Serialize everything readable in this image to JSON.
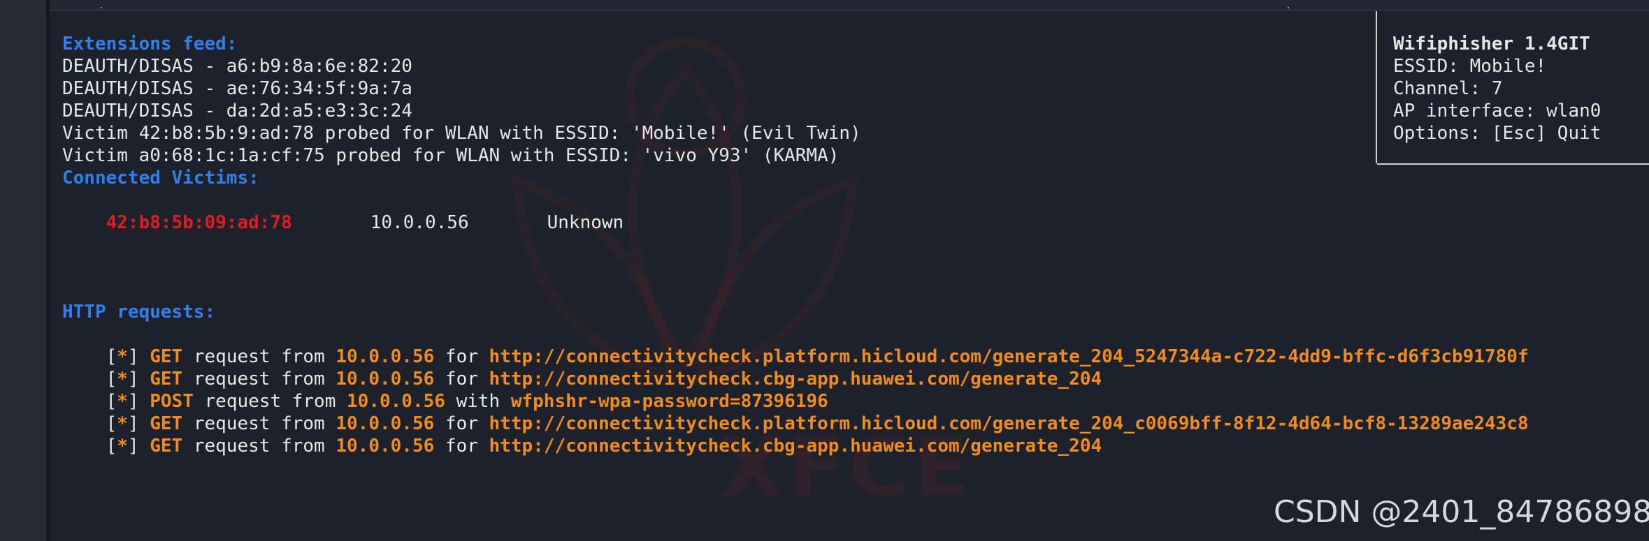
{
  "extensions": {
    "heading": "Extensions feed:",
    "lines": [
      "DEAUTH/DISAS - a6:b9:8a:6e:82:20",
      "DEAUTH/DISAS - ae:76:34:5f:9a:7a",
      "DEAUTH/DISAS - da:2d:a5:e3:3c:24",
      "Victim 42:b8:5b:9:ad:78 probed for WLAN with ESSID: 'Mobile!' (Evil Twin)",
      "Victim a0:68:1c:1a:cf:75 probed for WLAN with ESSID: 'vivo Y93' (KARMA)"
    ]
  },
  "victims": {
    "heading": "Connected Victims:",
    "rows": [
      {
        "mac": "42:b8:5b:09:ad:78",
        "ip": "10.0.0.56",
        "vendor": "Unknown"
      }
    ]
  },
  "info": {
    "title": "Wifiphisher 1.4GIT",
    "essid": "ESSID: Mobile!",
    "channel": "Channel: 7",
    "ap_interface": "AP interface: wlan0",
    "options": "Options: [Esc] Quit"
  },
  "http": {
    "heading": "HTTP requests:",
    "requests": [
      {
        "prefix": "[",
        "star": "*",
        "suffix": "] ",
        "method": "GET",
        "mid1": " request from ",
        "ip": "10.0.0.56",
        "mid2": " for ",
        "target": "http://connectivitycheck.platform.hicloud.com/generate_204_5247344a-c722-4dd9-bffc-d6f3cb91780f"
      },
      {
        "prefix": "[",
        "star": "*",
        "suffix": "] ",
        "method": "GET",
        "mid1": " request from ",
        "ip": "10.0.0.56",
        "mid2": " for ",
        "target": "http://connectivitycheck.cbg-app.huawei.com/generate_204"
      },
      {
        "prefix": "[",
        "star": "*",
        "suffix": "] ",
        "method": "POST",
        "mid1": " request from ",
        "ip": "10.0.0.56",
        "mid2": " with ",
        "target": "wfphshr-wpa-password=87396196"
      },
      {
        "prefix": "[",
        "star": "*",
        "suffix": "] ",
        "method": "GET",
        "mid1": " request from ",
        "ip": "10.0.0.56",
        "mid2": " for ",
        "target": "http://connectivitycheck.platform.hicloud.com/generate_204_c0069bff-8f12-4d64-bcf8-13289ae243c8"
      },
      {
        "prefix": "[",
        "star": "*",
        "suffix": "] ",
        "method": "GET",
        "mid1": " request from ",
        "ip": "10.0.0.56",
        "mid2": " for ",
        "target": "http://connectivitycheck.cbg-app.huawei.com/generate_204"
      }
    ]
  },
  "watermark": {
    "csdn": "CSDN @2401_84786898",
    "desktop": "XFCE"
  },
  "colors": {
    "background": "#1c212b",
    "heading": "#2f80ed",
    "victim_mac": "#e01b24",
    "highlight": "#f08c1e",
    "text": "#e6e6e6"
  }
}
